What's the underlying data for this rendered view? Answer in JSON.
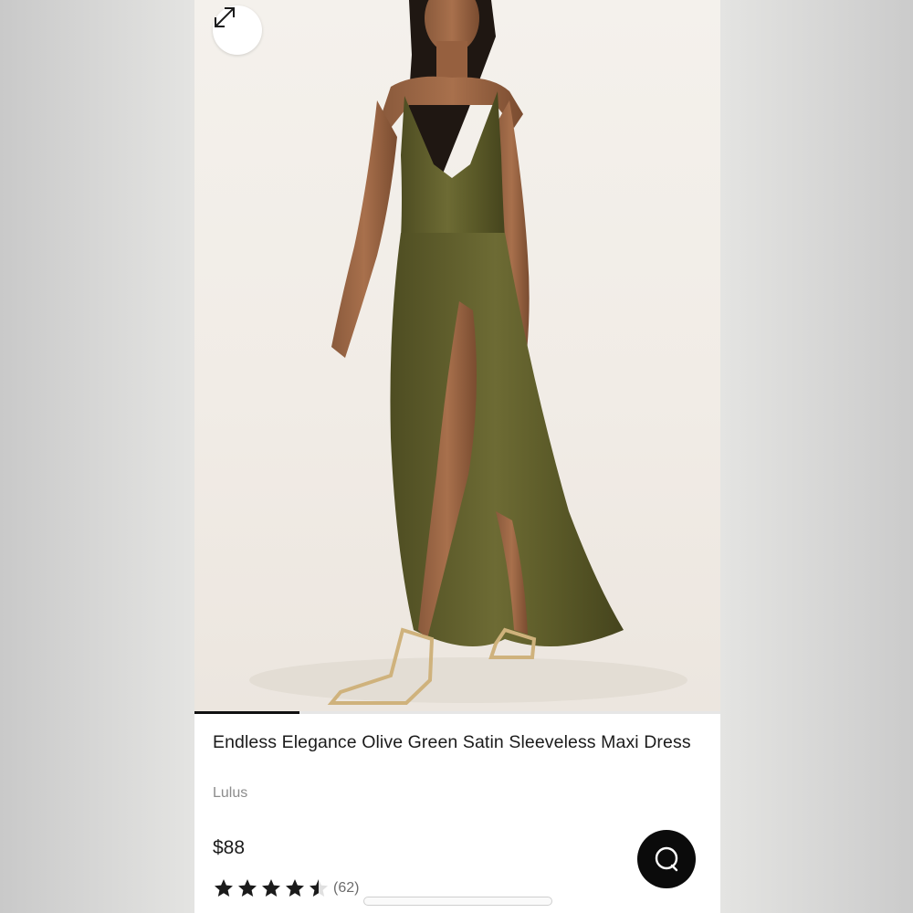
{
  "product": {
    "title": "Endless Elegance Olive Green Satin Sleeveless Maxi Dress",
    "brand": "Lulus",
    "price": "$88",
    "rating": 4.5,
    "review_count": "(62)"
  },
  "gallery": {
    "image_description": "Model wearing olive green satin maxi dress with gold strappy heels",
    "progress": 0.2,
    "expand_icon": "expand-arrows-icon"
  },
  "chat": {
    "icon": "chat-bubble-icon"
  },
  "colors": {
    "dress": "#5f5e2c",
    "text": "#1b1b1b",
    "muted": "#8c8c8c",
    "star": "#1b1b1b",
    "chat_button": "#0b0b0b"
  }
}
